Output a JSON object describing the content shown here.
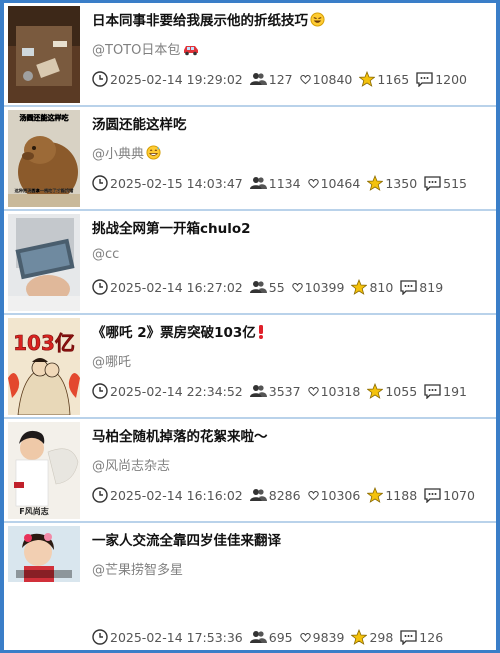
{
  "items": [
    {
      "title": "日本同事非要给我展示他的折纸技巧",
      "title_emoji": "rofl-emoji",
      "author": "@TOTO日本包",
      "author_emoji": "car-emoji",
      "date": "2025-02-14 19:29:02",
      "views": "127",
      "likes": "10840",
      "favorites": "1165",
      "comments": "1200",
      "thumb": "origami-on-table"
    },
    {
      "title": "汤圆还能这样吃",
      "title_emoji": "",
      "author": "@小典典",
      "author_emoji": "grin-sweat-emoji",
      "date": "2025-02-15 14:03:47",
      "views": "1134",
      "likes": "10464",
      "favorites": "1350",
      "comments": "515",
      "thumb": "capybara",
      "thumb_caption_top": "汤圆还能这样吃",
      "thumb_caption_bottom": "这种把汤圆拿一根吃了才能找错"
    },
    {
      "title": "挑战全网第一开箱chulo2",
      "title_emoji": "",
      "author": "@cc",
      "author_emoji": "",
      "date": "2025-02-14 16:27:02",
      "views": "55",
      "likes": "10399",
      "favorites": "810",
      "comments": "819",
      "thumb": "unboxing-tablet"
    },
    {
      "title": "《哪吒 2》票房突破103亿",
      "title_emoji": "exclamation-emoji",
      "author": "@哪吒",
      "author_emoji": "",
      "date": "2025-02-14 22:34:52",
      "views": "3537",
      "likes": "10318",
      "favorites": "1055",
      "comments": "191",
      "thumb": "nezha-poster",
      "thumb_caption_top": "103亿"
    },
    {
      "title": "马柏全随机掉落的花絮来啦～",
      "title_emoji": "",
      "author": "@风尚志杂志",
      "author_emoji": "",
      "date": "2025-02-14 16:16:02",
      "views": "8286",
      "likes": "10306",
      "favorites": "1188",
      "comments": "1070",
      "thumb": "magazine-portrait",
      "thumb_caption_bottom": "F风尚志"
    },
    {
      "title": "一家人交流全靠四岁佳佳来翻译",
      "title_emoji": "",
      "author": "@芒果捞智多星",
      "author_emoji": "",
      "date": "2025-02-14 17:53:36",
      "views": "695",
      "likes": "9839",
      "favorites": "298",
      "comments": "126",
      "thumb": "child-with-flowers"
    }
  ],
  "colors": {
    "background": "#3a7ec8",
    "divider": "#b9d2ea",
    "title": "#111111",
    "secondary_text": "#808080",
    "star": "#f4c20d"
  },
  "icons": {
    "date": "clock-icon",
    "views": "users-icon",
    "likes": "heart-icon",
    "favorites": "star-icon",
    "comments": "comment-icon"
  }
}
